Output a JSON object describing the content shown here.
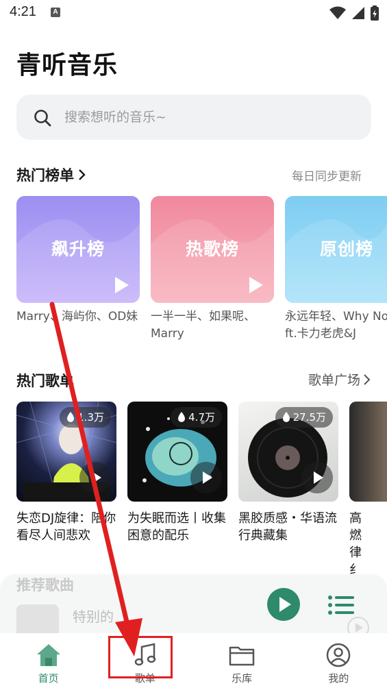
{
  "status_bar": {
    "time": "4:21",
    "notification": "A"
  },
  "app_title": "青听音乐",
  "search": {
    "placeholder": "搜索想听的音乐~"
  },
  "hot_charts": {
    "title": "热门榜单",
    "right_text": "每日同步更新",
    "cards": [
      {
        "label": "飙升榜",
        "desc": "Marry、海屿你、OD妹",
        "color_top": "#9b8ff0",
        "color_bottom": "#c7b4fb"
      },
      {
        "label": "热歌榜",
        "desc": "一半一半、如果呢、Marry",
        "color_top": "#f0899e",
        "color_bottom": "#f8b2bd"
      },
      {
        "label": "原创榜",
        "desc": "永远年轻、Why Not ft.卡力老虎&J",
        "color_top": "#7ecdf2",
        "color_bottom": "#a9e2fa"
      }
    ]
  },
  "hot_playlists": {
    "title": "热门歌单",
    "right_text": "歌单广场",
    "items": [
      {
        "name": "失恋DJ旋律：陪你看尽人间悲欢",
        "play_count": "1.3万"
      },
      {
        "name": "为失眠而选丨收集困意的配乐",
        "play_count": "4.7万"
      },
      {
        "name": "黑胶质感・华语流行典藏集",
        "play_count": "27.5万"
      },
      {
        "name": "高燃律纟",
        "play_count": ""
      }
    ]
  },
  "recommended": {
    "title": "推荐歌曲",
    "current_song": "特别的"
  },
  "bottom_nav": [
    {
      "label": "首页",
      "icon": "home-icon",
      "active": true
    },
    {
      "label": "歌单",
      "icon": "music-note-icon",
      "active": false
    },
    {
      "label": "乐库",
      "icon": "folder-icon",
      "active": false
    },
    {
      "label": "我的",
      "icon": "user-icon",
      "active": false
    }
  ],
  "colors": {
    "accent": "#2d8a6a",
    "annotation": "#e02020"
  }
}
